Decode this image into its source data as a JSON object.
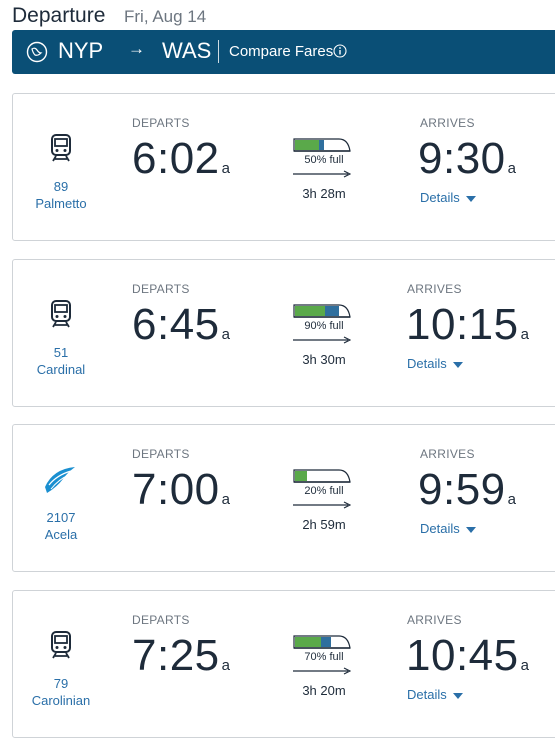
{
  "header": {
    "title": "Departure",
    "date": "Fri, Aug 14"
  },
  "route": {
    "from": "NYP",
    "arrow": "→",
    "to": "WAS",
    "compare_label": "Compare Fares"
  },
  "labels": {
    "departs": "DEPARTS",
    "arrives": "ARRIVES",
    "details": "Details"
  },
  "colors": {
    "route_bar": "#0a4f76",
    "link": "#2a6fa8",
    "text": "#1e2b3a",
    "label": "#6d7680"
  },
  "trains": [
    {
      "number": "89",
      "name": "Palmetto",
      "icon": "train-icon",
      "depart": "6:02",
      "depart_ampm": "a",
      "arrive": "9:30",
      "arrive_ampm": "a",
      "occupancy": "50% full",
      "occupancy_level": 0.5,
      "duration": "3h 28m"
    },
    {
      "number": "51",
      "name": "Cardinal",
      "icon": "train-icon",
      "depart": "6:45",
      "depart_ampm": "a",
      "arrive": "10:15",
      "arrive_ampm": "a",
      "occupancy": "90% full",
      "occupancy_level": 0.9,
      "duration": "3h 30m"
    },
    {
      "number": "2107",
      "name": "Acela",
      "icon": "acela-wing-icon",
      "depart": "7:00",
      "depart_ampm": "a",
      "arrive": "9:59",
      "arrive_ampm": "a",
      "occupancy": "20% full",
      "occupancy_level": 0.2,
      "duration": "2h 59m"
    },
    {
      "number": "79",
      "name": "Carolinian",
      "icon": "train-icon",
      "depart": "7:25",
      "depart_ampm": "a",
      "arrive": "10:45",
      "arrive_ampm": "a",
      "occupancy": "70% full",
      "occupancy_level": 0.7,
      "duration": "3h 20m"
    }
  ]
}
